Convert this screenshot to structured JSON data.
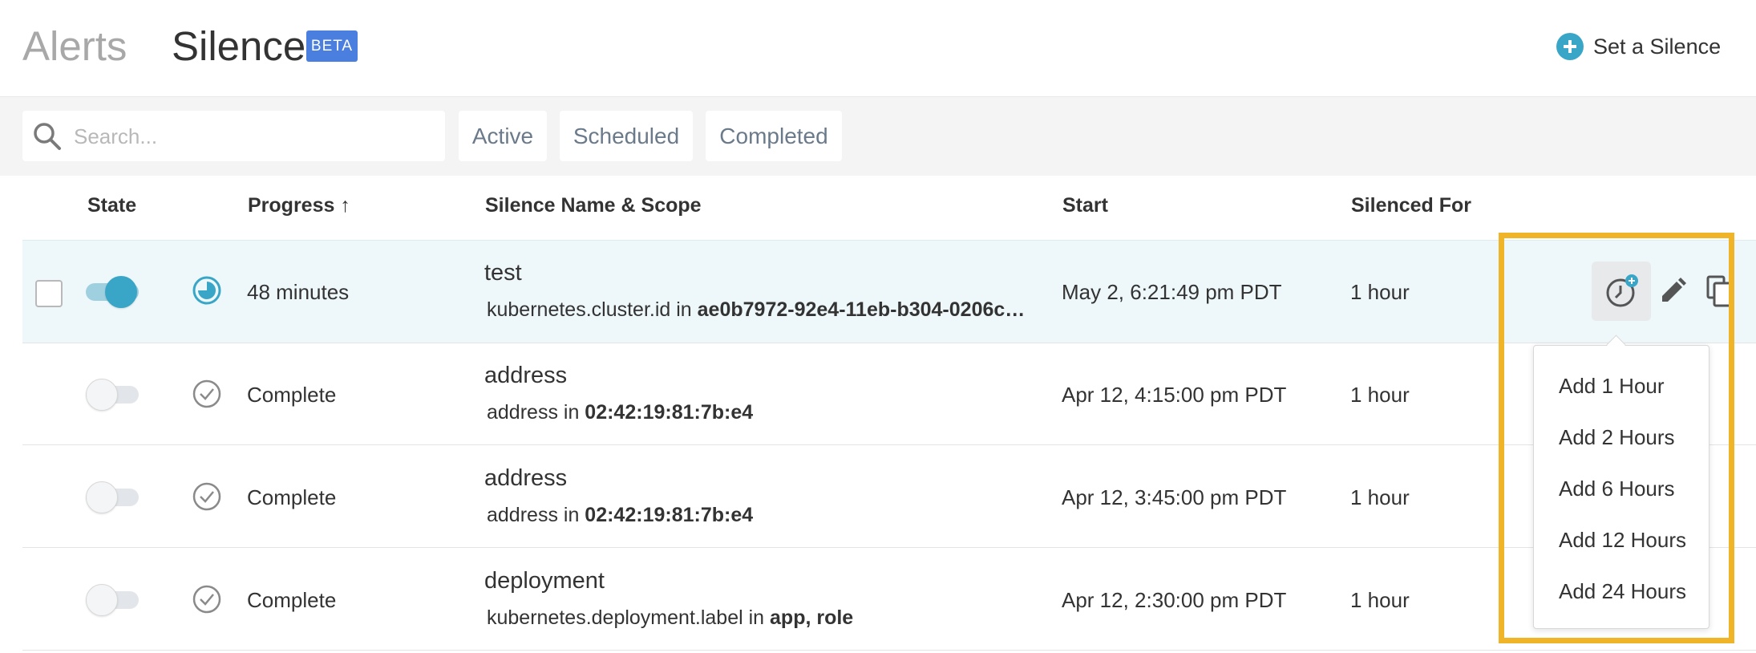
{
  "header": {
    "tab_alerts": "Alerts",
    "tab_silence": "Silence",
    "beta_badge": "BETA",
    "set_silence_label": "Set a Silence"
  },
  "filters": {
    "search_placeholder": "Search...",
    "buttons": [
      "Active",
      "Scheduled",
      "Completed"
    ]
  },
  "table": {
    "columns": {
      "state": "State",
      "progress": "Progress ↑",
      "name_scope": "Silence Name & Scope",
      "start": "Start",
      "silenced_for": "Silenced For"
    },
    "rows": [
      {
        "state_on": true,
        "progress": "48 minutes",
        "name": "test",
        "scope_prefix": "kubernetes.cluster.id in ",
        "scope_value": "ae0b7972-92e4-11eb-b304-0206c…",
        "start": "May 2, 6:21:49 pm PDT",
        "silenced_for": "1 hour"
      },
      {
        "state_on": false,
        "progress": "Complete",
        "name": "address",
        "scope_prefix": "address in ",
        "scope_value": "02:42:19:81:7b:e4",
        "start": "Apr 12, 4:15:00 pm PDT",
        "silenced_for": "1 hour"
      },
      {
        "state_on": false,
        "progress": "Complete",
        "name": "address",
        "scope_prefix": "address in ",
        "scope_value": "02:42:19:81:7b:e4",
        "start": "Apr 12, 3:45:00 pm PDT",
        "silenced_for": "1 hour"
      },
      {
        "state_on": false,
        "progress": "Complete",
        "name": "deployment",
        "scope_prefix": "kubernetes.deployment.label in ",
        "scope_value": "app, role",
        "start": "Apr 12, 2:30:00 pm PDT",
        "silenced_for": "1 hour"
      }
    ]
  },
  "extend_menu": {
    "items": [
      "Add 1 Hour",
      "Add 2 Hours",
      "Add 6 Hours",
      "Add 12 Hours",
      "Add 24 Hours"
    ]
  },
  "colors": {
    "accent": "#3aa6c7",
    "beta": "#4a7fe0",
    "highlight": "#f0b429",
    "active_row": "#eef7f9"
  },
  "icons": [
    "plus-circle-icon",
    "search-icon",
    "progress-clock-icon",
    "check-circle-icon",
    "add-time-icon",
    "pencil-icon",
    "copy-icon"
  ]
}
